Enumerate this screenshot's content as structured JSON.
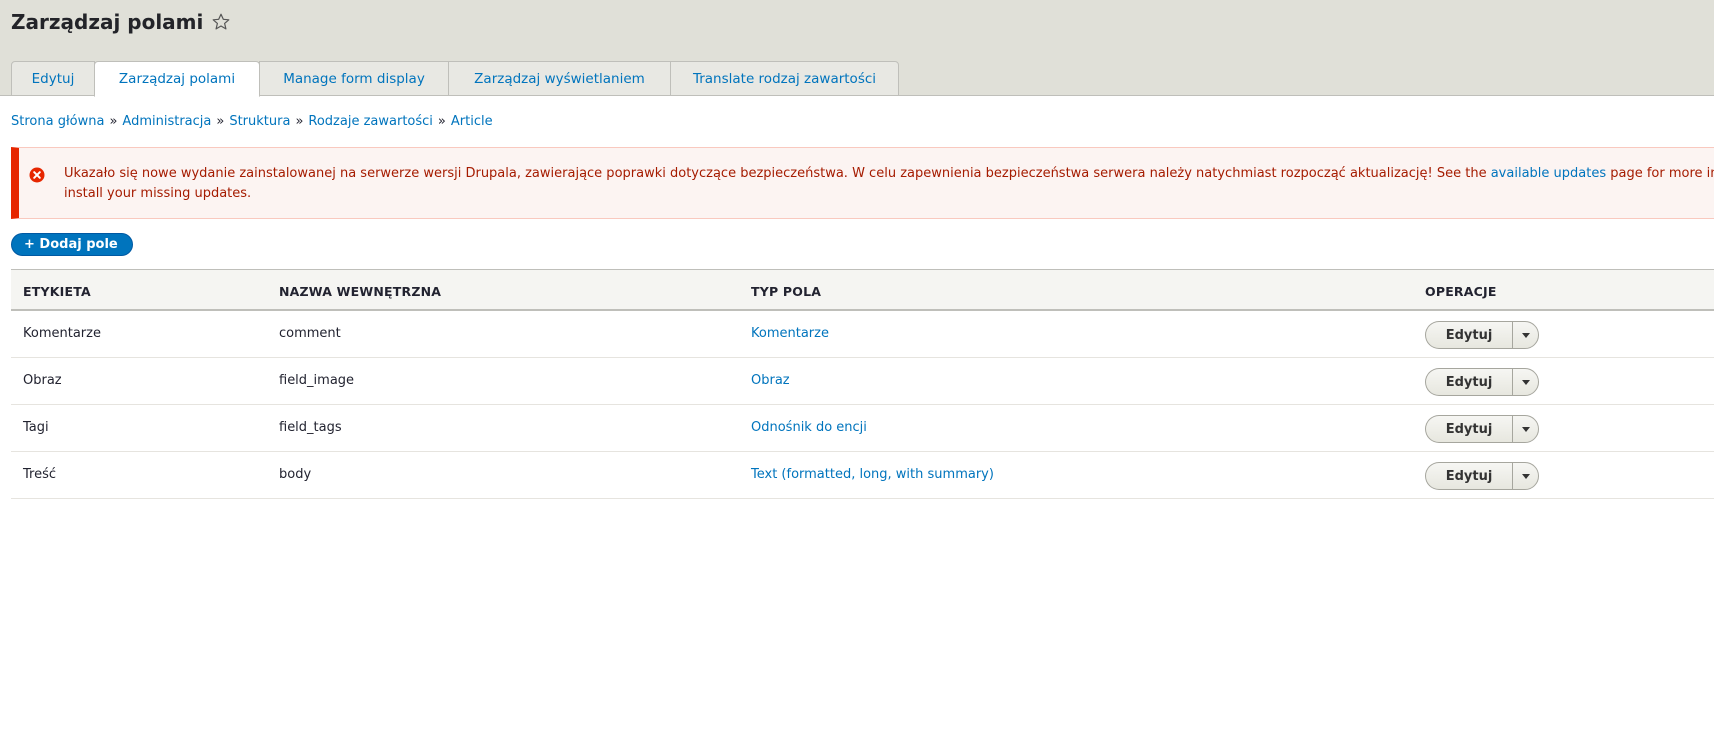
{
  "page": {
    "title": "Zarządzaj polami",
    "star_icon": "star-outline-icon"
  },
  "tabs": [
    {
      "label": "Edytuj",
      "active": false
    },
    {
      "label": "Zarządzaj polami",
      "active": true
    },
    {
      "label": "Manage form display",
      "active": false
    },
    {
      "label": "Zarządzaj wyświetlaniem",
      "active": false
    },
    {
      "label": "Translate rodzaj zawartości",
      "active": false
    }
  ],
  "breadcrumb": {
    "items": [
      "Strona główna",
      "Administracja",
      "Struktura",
      "Rodzaje zawartości",
      "Article"
    ],
    "separator": "»"
  },
  "alert": {
    "icon": "error-circle-icon",
    "text_before_link": "Ukazało się nowe wydanie zainstalowanej na serwerze wersji Drupala, zawierające poprawki dotyczące bezpieczeństwa. W celu zapewnienia bezpieczeństwa serwera należy natychmiast rozpocząć aktualizację! See the ",
    "link_text": "available updates",
    "text_after_link": " page for more in",
    "text_line2": "install your missing updates.",
    "color": "#a51b00",
    "border_color": "#e62600"
  },
  "actions": {
    "add_field_label": "+ Dodaj pole",
    "accent": "#0074bd"
  },
  "table": {
    "headers": [
      "ETYKIETA",
      "NAZWA WEWNĘTRZNA",
      "TYP POLA",
      "OPERACJE"
    ],
    "rows": [
      {
        "label": "Komentarze",
        "machine_name": "comment",
        "field_type": "Komentarze",
        "op": "Edytuj"
      },
      {
        "label": "Obraz",
        "machine_name": "field_image",
        "field_type": "Obraz",
        "op": "Edytuj"
      },
      {
        "label": "Tagi",
        "machine_name": "field_tags",
        "field_type": "Odnośnik do encji",
        "op": "Edytuj"
      },
      {
        "label": "Treść",
        "machine_name": "body",
        "field_type": "Text (formatted, long, with summary)",
        "op": "Edytuj"
      }
    ]
  }
}
